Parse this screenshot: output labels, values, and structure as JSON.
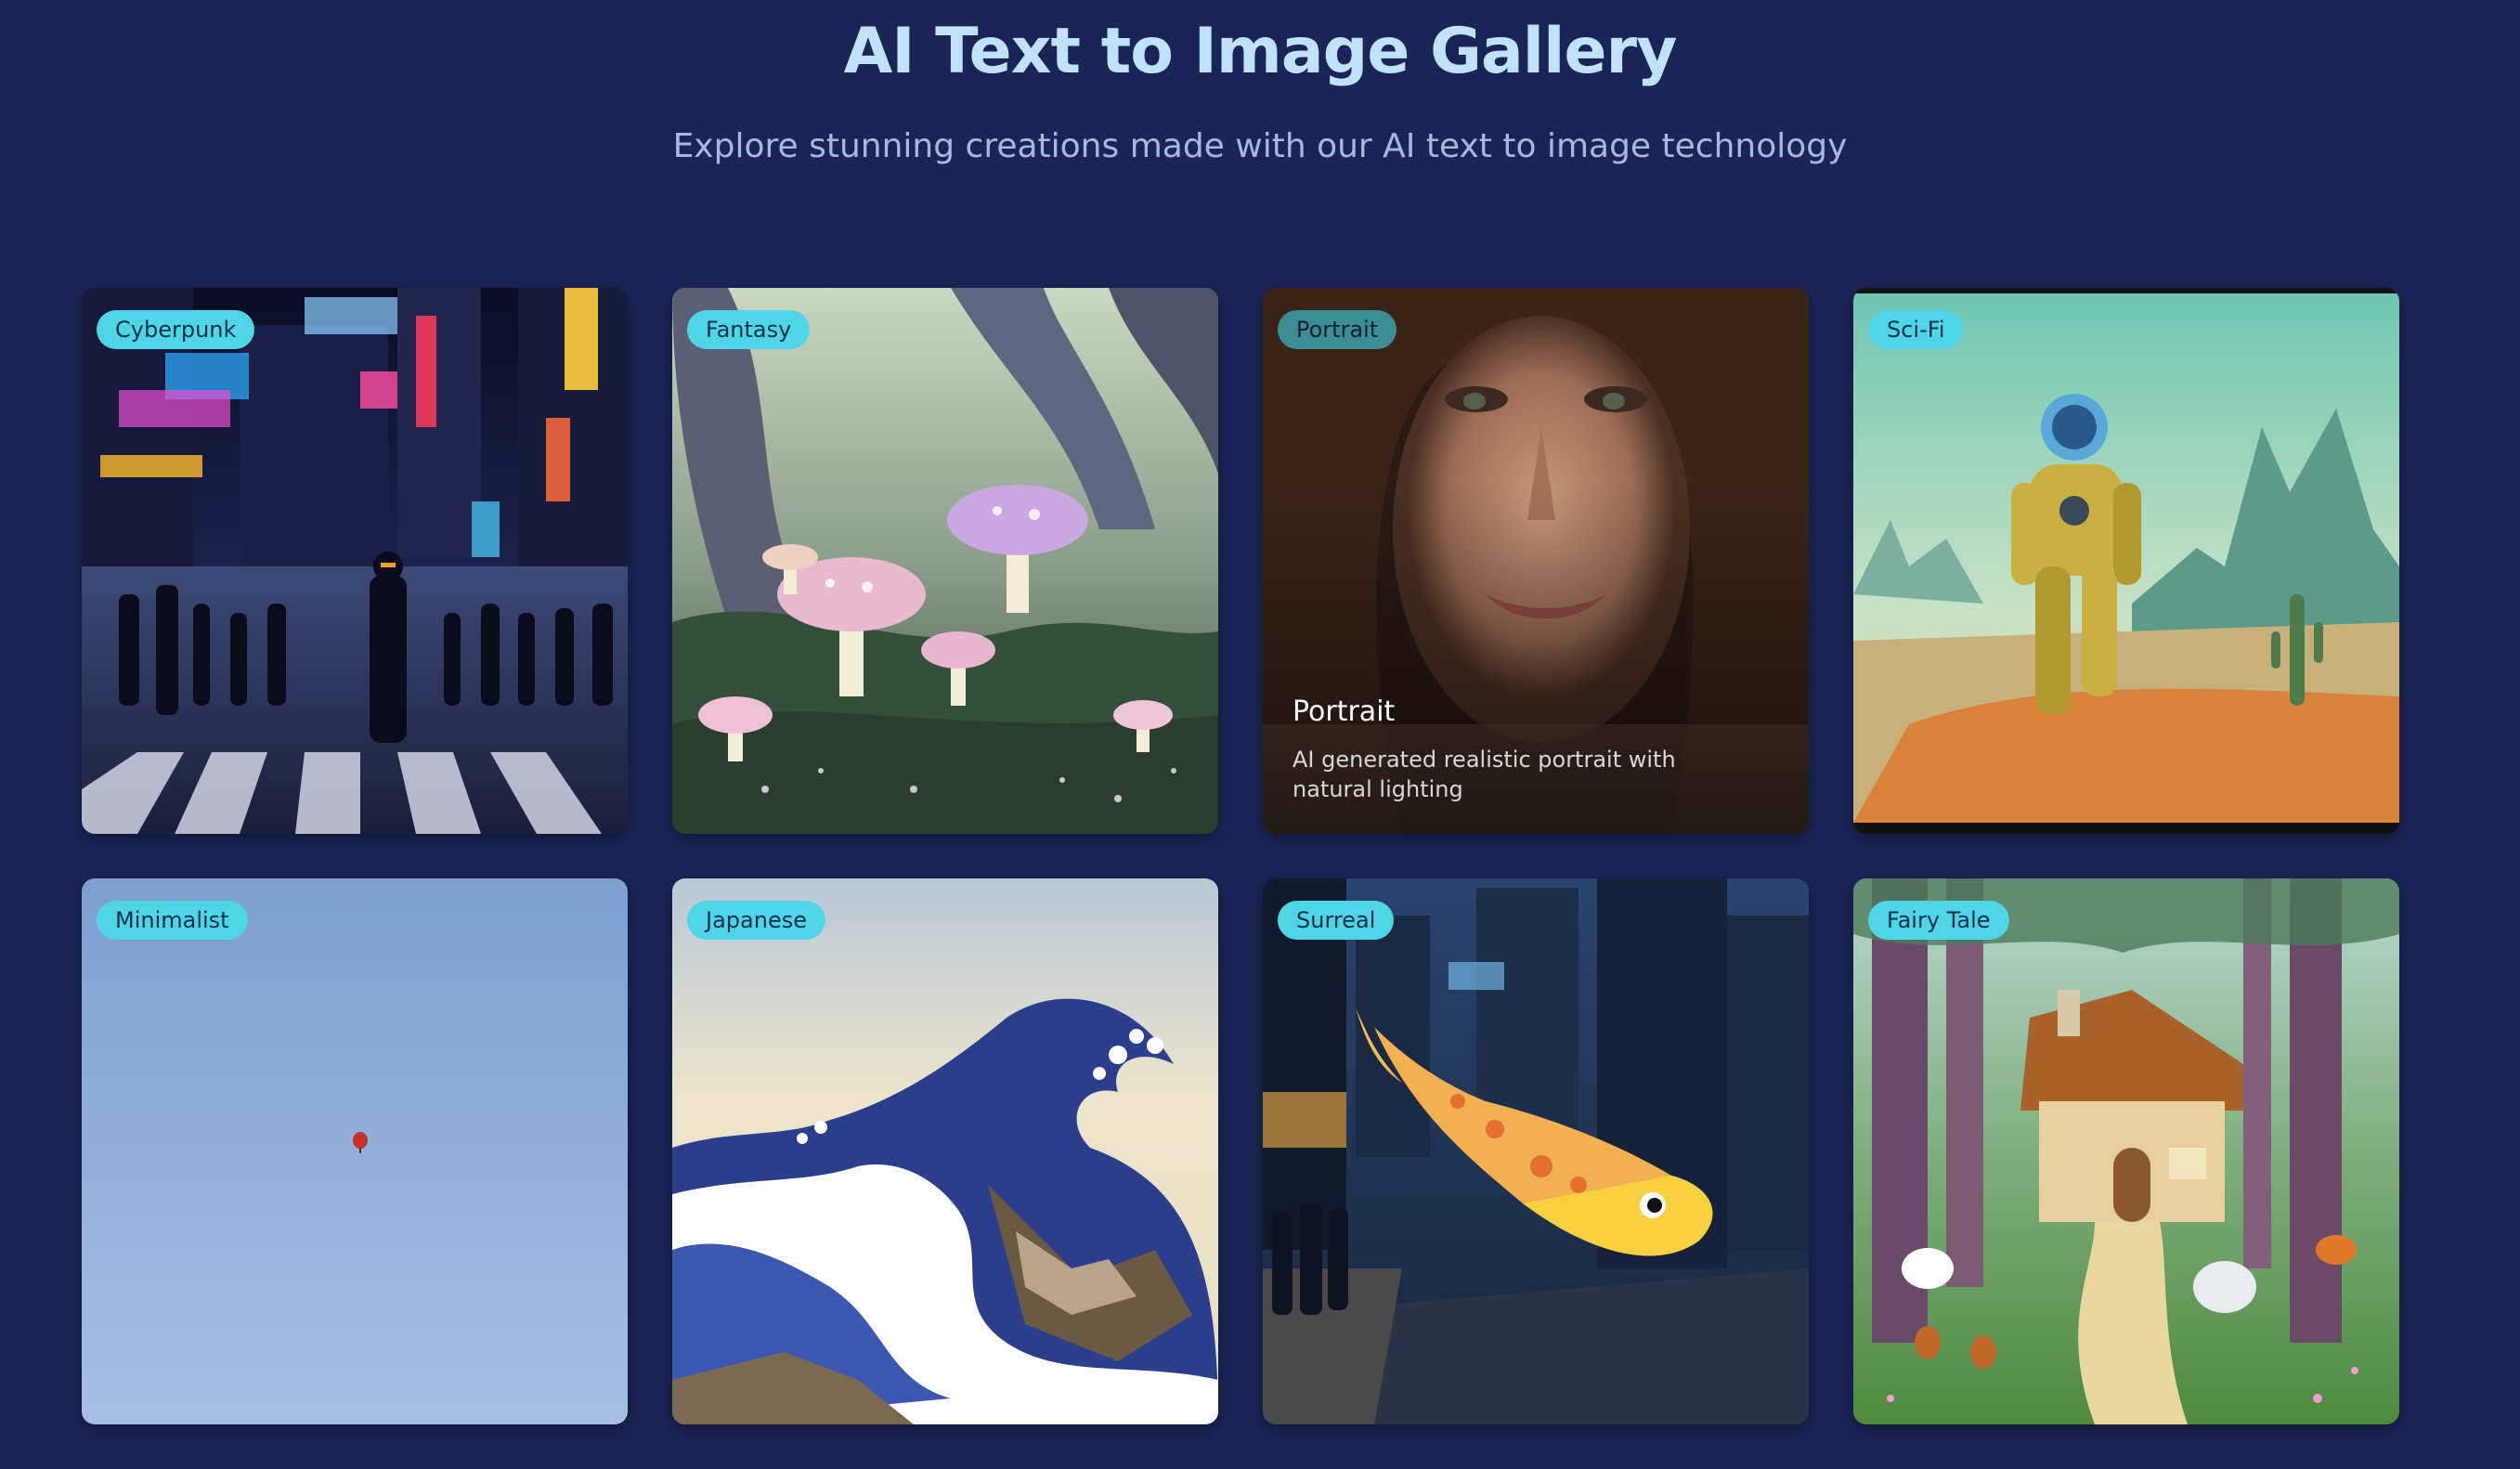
{
  "header": {
    "title": "AI Text to Image Gallery",
    "subtitle": "Explore stunning creations made with our AI text to image technology"
  },
  "colors": {
    "background": "#1b2456",
    "title": "#bfe2ff",
    "tag_background": "#4fd6e6"
  },
  "gallery": {
    "items": [
      {
        "tag": "Cyberpunk",
        "image": "cyberpunk-city-street-image"
      },
      {
        "tag": "Fantasy",
        "image": "mushroom-forest-image"
      },
      {
        "tag": "Portrait",
        "image": "woman-portrait-image",
        "overlay_title": "Portrait",
        "overlay_description": "AI generated realistic portrait with natural lighting"
      },
      {
        "tag": "Sci-Fi",
        "image": "robot-desert-image"
      },
      {
        "tag": "Minimalist",
        "image": "balloon-sky-image"
      },
      {
        "tag": "Japanese",
        "image": "great-wave-image"
      },
      {
        "tag": "Surreal",
        "image": "giant-koi-city-image"
      },
      {
        "tag": "Fairy Tale",
        "image": "forest-cottage-image"
      }
    ]
  }
}
